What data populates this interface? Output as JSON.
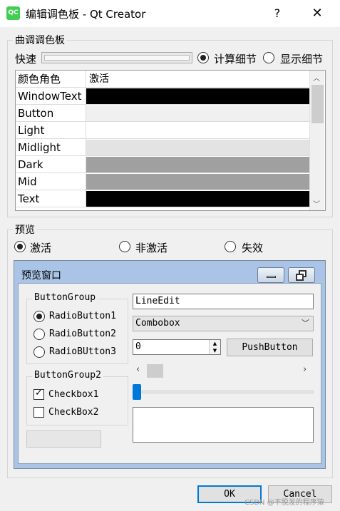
{
  "window": {
    "icon_label": "QC",
    "title": "编辑调色板 - Qt Creator",
    "help_label": "?",
    "close_label": "✕"
  },
  "tune_group": {
    "title": "曲调调色板",
    "fast_label": "快速",
    "radio_compute": "计算细节",
    "radio_show": "显示细节",
    "compute_checked": true
  },
  "roles_table": {
    "headers": [
      "颜色角色",
      "激活"
    ],
    "rows": [
      {
        "role": "WindowText",
        "color": "#000000"
      },
      {
        "role": "Button",
        "color": "#f0f0f0"
      },
      {
        "role": "Light",
        "color": "#ffffff"
      },
      {
        "role": "Midlight",
        "color": "#e3e3e3"
      },
      {
        "role": "Dark",
        "color": "#a0a0a0"
      },
      {
        "role": "Mid",
        "color": "#a0a0a0"
      },
      {
        "role": "Text",
        "color": "#000000"
      }
    ]
  },
  "preview_group": {
    "title": "预览",
    "radio_active": "激活",
    "radio_inactive": "非激活",
    "radio_disabled": "失效"
  },
  "preview_window": {
    "title": "预览窗口",
    "button_group": {
      "title": "ButtonGroup",
      "items": [
        "RadioButton1",
        "RadioButton2",
        "RadioBUtton3"
      ]
    },
    "button_group2": {
      "title": "ButtonGroup2",
      "items": [
        {
          "label": "Checkbox1",
          "checked": true
        },
        {
          "label": "CheckBox2",
          "checked": false
        }
      ]
    },
    "line_edit_value": "LineEdit",
    "combobox_value": "Combobox",
    "spinbox_value": "0",
    "push_button_label": "PushButton",
    "slider_value": 0
  },
  "dialog_buttons": {
    "ok": "OK",
    "cancel": "Cancel"
  },
  "watermark": "CSDN @不脱发的程序猿"
}
